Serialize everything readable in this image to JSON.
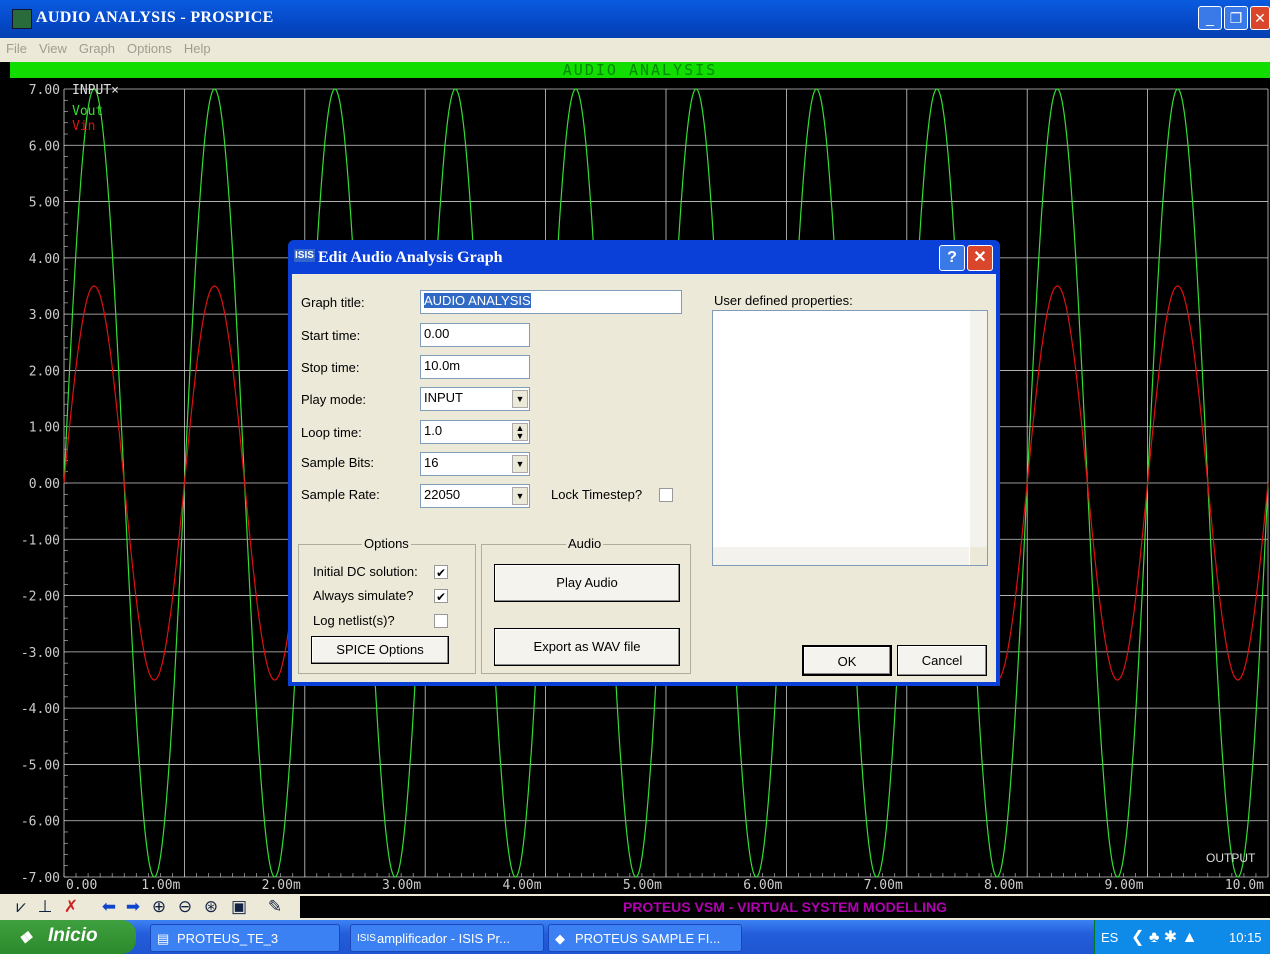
{
  "window": {
    "title": "AUDIO ANALYSIS - PROSPICE"
  },
  "menu": [
    "File",
    "View",
    "Graph",
    "Options",
    "Help"
  ],
  "graph": {
    "header": "AUDIO ANALYSIS",
    "legend": [
      "INPUT×",
      "Vout",
      "Vin"
    ],
    "output_label": "OUTPUT"
  },
  "chart_data": {
    "type": "line",
    "title": "AUDIO ANALYSIS",
    "x": [
      0,
      1,
      2,
      3,
      4,
      5,
      6,
      7,
      8,
      9,
      10
    ],
    "x_ticks": [
      "0.00",
      "1.00m",
      "2.00m",
      "3.00m",
      "4.00m",
      "5.00m",
      "6.00m",
      "7.00m",
      "8.00m",
      "9.00m",
      "10.0m"
    ],
    "y_ticks": [
      "7.00",
      "6.00",
      "5.00",
      "4.00",
      "3.00",
      "2.00",
      "1.00",
      "0.00",
      "-1.00",
      "-2.00",
      "-3.00",
      "-4.00",
      "-5.00",
      "-6.00",
      "-7.00"
    ],
    "xlim": [
      0,
      10
    ],
    "ylim": [
      -7,
      7
    ],
    "grid": true,
    "series": [
      {
        "name": "Vout",
        "color": "#33dd33",
        "amplitude": 7.0,
        "frequency_khz": 1.0,
        "description": "sine, 10 cycles"
      },
      {
        "name": "Vin",
        "color": "#dd1111",
        "amplitude": 3.5,
        "frequency_khz": 1.0,
        "description": "sine, 10 cycles"
      }
    ]
  },
  "bottom": {
    "status": "PROTEUS VSM - VIRTUAL SYSTEM MODELLING"
  },
  "dialog": {
    "title": "Edit Audio Analysis Graph",
    "graph_title_label": "Graph title:",
    "graph_title_value": "AUDIO ANALYSIS",
    "start_time_label": "Start time:",
    "start_time_value": "0.00",
    "stop_time_label": "Stop time:",
    "stop_time_value": "10.0m",
    "play_mode_label": "Play mode:",
    "play_mode_value": "INPUT",
    "loop_time_label": "Loop time:",
    "loop_time_value": "1.0",
    "sample_bits_label": "Sample Bits:",
    "sample_bits_value": "16",
    "sample_rate_label": "Sample Rate:",
    "sample_rate_value": "22050",
    "lock_timestep_label": "Lock Timestep?",
    "user_props_label": "User defined properties:",
    "options_group": "Options",
    "initial_dc_label": "Initial DC solution:",
    "always_simulate_label": "Always simulate?",
    "log_netlist_label": "Log netlist(s)?",
    "spice_options_label": "SPICE Options",
    "audio_group": "Audio",
    "play_audio_label": "Play Audio",
    "export_wav_label": "Export as WAV file",
    "ok_label": "OK",
    "cancel_label": "Cancel",
    "check_mark": "✔"
  },
  "taskbar": {
    "start": "Inicio",
    "tasks": [
      "PROTEUS_TE_3",
      "amplificador - ISIS Pr...",
      "PROTEUS SAMPLE FI..."
    ],
    "lang": "ES",
    "clock": "10:15"
  }
}
